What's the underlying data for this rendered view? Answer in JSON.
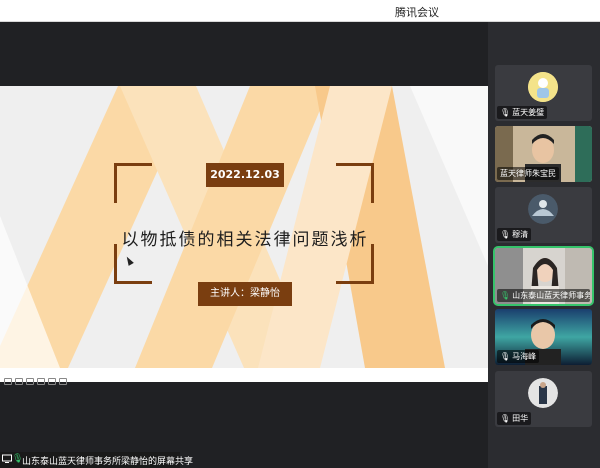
{
  "app": {
    "window_title": "腾讯会议"
  },
  "slide": {
    "date": "2022.12.03",
    "title": "以物抵债的相关法律问题浅析",
    "speaker": "主讲人：梁静怡"
  },
  "participants": [
    {
      "name": "蓝天姜璧",
      "mic": "muted"
    },
    {
      "name": "蓝天律师朱宝民",
      "mic": "none"
    },
    {
      "name": "穆清",
      "mic": "muted"
    },
    {
      "name": "山东泰山蓝天律师事务所...",
      "mic": "active"
    },
    {
      "name": "马海峰",
      "mic": "muted"
    },
    {
      "name": "田华",
      "mic": "muted"
    }
  ],
  "status": {
    "share_text": "山东泰山蓝天律师事务所梁静怡的屏幕共享"
  },
  "colors": {
    "accent": "#7a3e10",
    "green": "#36c46b",
    "sidebar": "#2b2c30"
  }
}
